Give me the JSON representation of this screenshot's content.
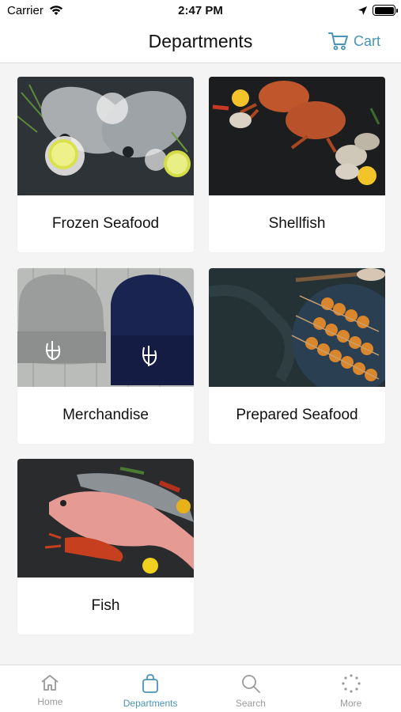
{
  "status": {
    "carrier": "Carrier",
    "time": "2:47 PM"
  },
  "nav": {
    "title": "Departments",
    "cart_label": "Cart"
  },
  "departments": [
    {
      "label": "Frozen Seafood"
    },
    {
      "label": "Shellfish"
    },
    {
      "label": "Merchandise"
    },
    {
      "label": "Prepared Seafood"
    },
    {
      "label": "Fish"
    }
  ],
  "tabs": [
    {
      "label": "Home",
      "icon": "home-icon"
    },
    {
      "label": "Departments",
      "icon": "bag-icon",
      "active": true
    },
    {
      "label": "Search",
      "icon": "search-icon"
    },
    {
      "label": "More",
      "icon": "more-icon"
    }
  ],
  "colors": {
    "accent": "#4a94b8",
    "inactive": "#9a9a9a",
    "background": "#f4f4f4"
  }
}
